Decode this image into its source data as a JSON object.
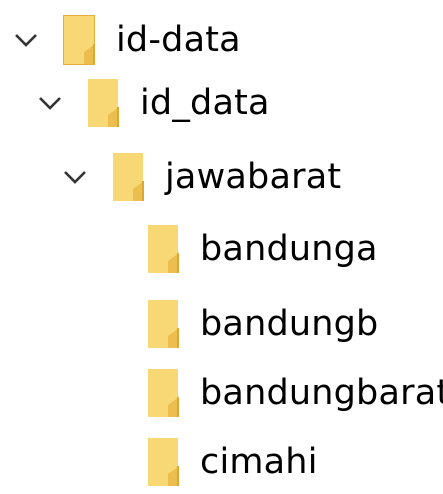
{
  "tree": {
    "nodes": [
      {
        "label": "id-data",
        "expanded": true,
        "level": 0
      },
      {
        "label": "id_data",
        "expanded": true,
        "level": 1
      },
      {
        "label": "jawabarat",
        "expanded": true,
        "level": 2
      },
      {
        "label": "bandunga",
        "expanded": false,
        "level": 3
      },
      {
        "label": "bandungb",
        "expanded": false,
        "level": 3
      },
      {
        "label": "bandungbarat",
        "expanded": false,
        "level": 3
      },
      {
        "label": "cimahi",
        "expanded": false,
        "level": 3
      }
    ]
  },
  "icons": {
    "chevron": "chevron-down-icon",
    "folder": "folder-icon"
  },
  "colors": {
    "folder_fill": "#f8d775",
    "folder_edge": "#e0b13e",
    "folder_back": "#f3cb5c",
    "chevron": "#333333",
    "text": "#000000"
  }
}
